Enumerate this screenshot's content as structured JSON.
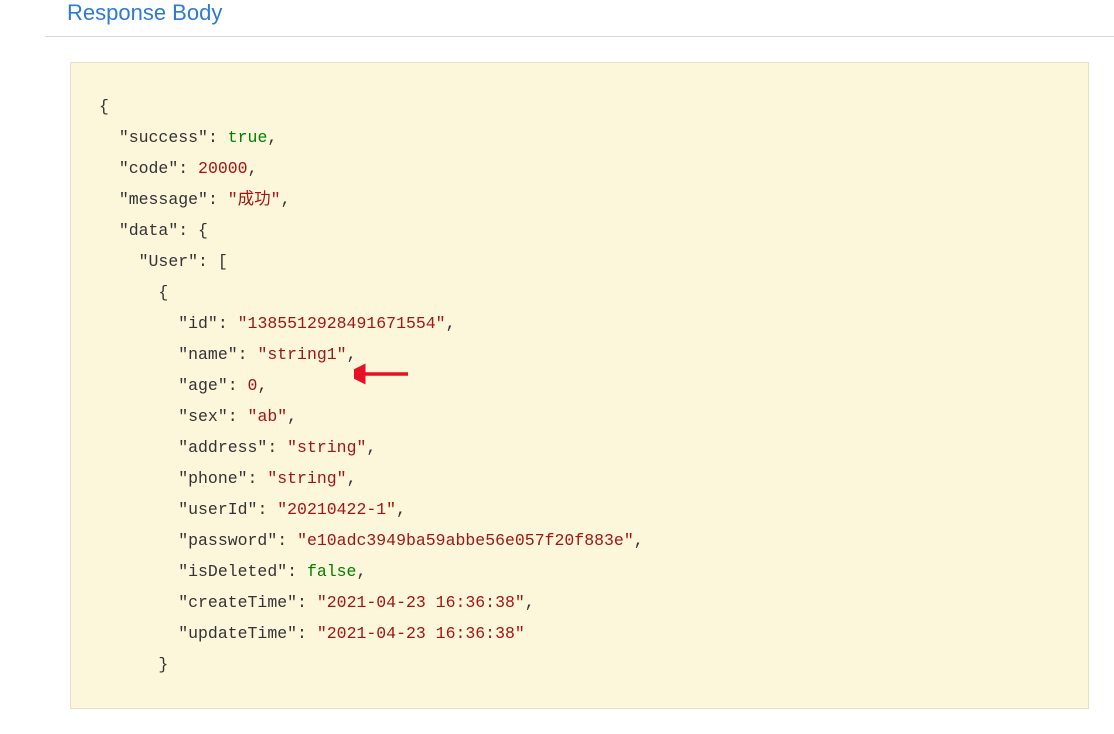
{
  "section_title": "Response Body",
  "json": {
    "success_key": "\"success\"",
    "success_val": "true",
    "code_key": "\"code\"",
    "code_val": "20000",
    "message_key": "\"message\"",
    "message_val": "\"成功\"",
    "data_key": "\"data\"",
    "user_key": "\"User\"",
    "id_key": "\"id\"",
    "id_val": "\"1385512928491671554\"",
    "name_key": "\"name\"",
    "name_val": "\"string1\"",
    "age_key": "\"age\"",
    "age_val": "0",
    "sex_key": "\"sex\"",
    "sex_val": "\"ab\"",
    "address_key": "\"address\"",
    "address_val": "\"string\"",
    "phone_key": "\"phone\"",
    "phone_val": "\"string\"",
    "userId_key": "\"userId\"",
    "userId_val": "\"20210422-1\"",
    "password_key": "\"password\"",
    "password_val": "\"e10adc3949ba59abbe56e057f20f883e\"",
    "isDeleted_key": "\"isDeleted\"",
    "isDeleted_val": "false",
    "createTime_key": "\"createTime\"",
    "createTime_val": "\"2021-04-23 16:36:38\"",
    "updateTime_key": "\"updateTime\"",
    "updateTime_val": "\"2021-04-23 16:36:38\""
  }
}
